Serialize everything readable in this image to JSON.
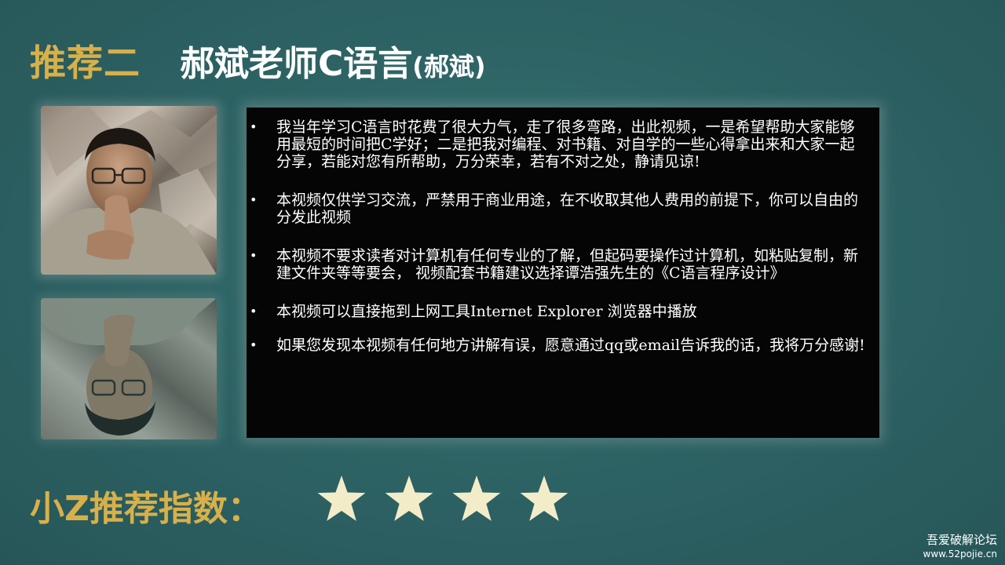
{
  "title": {
    "tag": "推荐二",
    "main": "郝斌老师C语言",
    "sub": "(郝斌)"
  },
  "bullets": [
    "我当年学习C语言时花费了很大力气，走了很多弯路，出此视频，一是希望帮助大家能够用最短的时间把C学好；二是把我对编程、对书籍、对自学的一些心得拿出来和大家一起分享，若能对您有所帮助，万分荣幸，若有不对之处，静请见谅!",
    "本视频仅供学习交流，严禁用于商业用途，在不收取其他人费用的前提下，你可以自由的分发此视频",
    "本视频不要求读者对计算机有任何专业的了解，但起码要操作过计算机，如粘贴复制，新建文件夹等等要会， 视频配套书籍建议选择谭浩强先生的《C语言程序设计》",
    "本视频可以直接拖到上网工具Internet Explorer 浏览器中播放",
    "如果您发现本视频有任何地方讲解有误，愿意通过qq或email告诉我的话，我将万分感谢!"
  ],
  "bullet_glyph": "•",
  "rating": {
    "label": "小Z推荐指数：",
    "stars": 4,
    "star_color": "#f3ecc8"
  },
  "watermark": {
    "line1": "吾爱破解论坛",
    "line2": "www.52pojie.cn"
  },
  "colors": {
    "background": "#2e6264",
    "accent_gold": "#d8b04a",
    "panel": "#050505",
    "text": "#ffffff"
  },
  "icons": [
    "portrait-photo",
    "portrait-reflection",
    "star-icon"
  ]
}
